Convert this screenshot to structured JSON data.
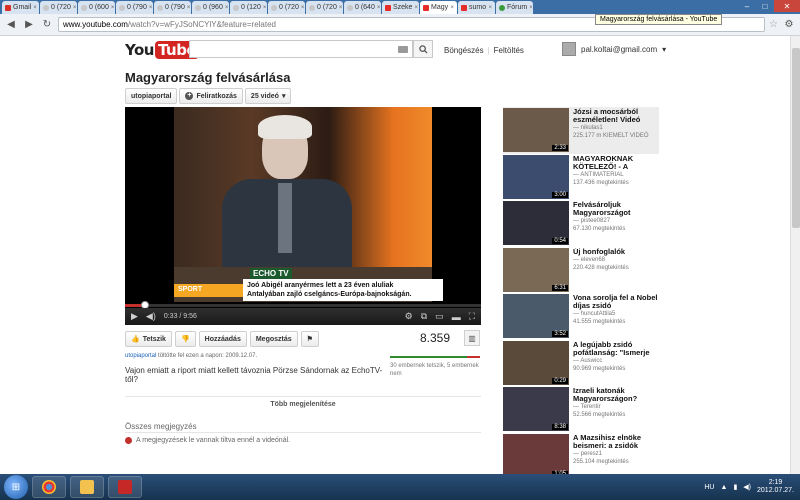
{
  "browser": {
    "tabs": [
      {
        "label": "Gmail",
        "icon": "gmail-icon",
        "active": false
      },
      {
        "label": "0 (720",
        "icon": "globe-icon",
        "active": false
      },
      {
        "label": "0 (600",
        "icon": "globe-icon",
        "active": false
      },
      {
        "label": "0 (790",
        "icon": "globe-icon",
        "active": false
      },
      {
        "label": "0 (790",
        "icon": "globe-icon",
        "active": false
      },
      {
        "label": "0 (960",
        "icon": "globe-icon",
        "active": false
      },
      {
        "label": "0 (120",
        "icon": "globe-icon",
        "active": false
      },
      {
        "label": "0 (720",
        "icon": "globe-icon",
        "active": false
      },
      {
        "label": "0 (720",
        "icon": "globe-icon",
        "active": false
      },
      {
        "label": "0 (640",
        "icon": "globe-icon",
        "active": false
      },
      {
        "label": "Szeke",
        "icon": "youtube-icon",
        "active": false
      },
      {
        "label": "Magy",
        "icon": "youtube-icon",
        "active": true
      },
      {
        "label": "sumo",
        "icon": "youtube-icon",
        "active": false
      },
      {
        "label": "Fórum",
        "icon": "green-icon",
        "active": false
      }
    ],
    "tooltip": "Magyarország felvásárlása - YouTube",
    "url_host": "www.youtube.com",
    "url_path": "/watch?v=wFyJSoNCYlY&feature=related"
  },
  "header": {
    "logo_you": "You",
    "logo_tube": "Tube",
    "browse": "Böngészés",
    "upload": "Feltöltés",
    "account": "pal.koltai@gmail.com",
    "account_caret": "▾"
  },
  "video": {
    "title": "Magyarország felvásárlása",
    "channel": "utopiaportal",
    "subscribe": "Feliratkozás",
    "count": "25 videó",
    "overlay_logo": "ECHO TV",
    "overlay_label": "SPORT",
    "overlay_line1": "Joó Abigél aranyérmes lett a 23 éven aluliak",
    "overlay_line2": "Antalyában zajló cselgáncs-Európa-bajnokságán.",
    "time": "0:33 / 9:56",
    "progress": 0.055,
    "like": "Tetszik",
    "add": "Hozzáadás",
    "share": "Megosztás",
    "views": "8.359",
    "like_ratio": 0.857,
    "likes_text": "30 embernek tetszik, 5 embernek nem",
    "uploader_name": "utopiaportal",
    "uploader_text": " töltötte fel ezen a napon: 2009.12.07.",
    "description": "Vajon emiatt a riport miatt kellett távoznia Pörzse Sándornak az EchoTV-től?",
    "more": "Több megjelenítése",
    "comments_header": "Összes megjegyzés",
    "comments_disabled": "A megjegyzések le vannak tiltva ennél a videónál."
  },
  "sidebar": {
    "items": [
      {
        "title": "Józsi a mocsárból eszméletlen! Videó",
        "channel": "— nikulas1",
        "views": "225.177 m",
        "badge": "KIEMELT VIDEÓ",
        "duration": "2:33"
      },
      {
        "title": "MAGYAROKNAK KÖTELEZŐ! - A",
        "channel": "— ANTIMATERIAL",
        "views": "137.436 megtekintés",
        "badge": "",
        "duration": "3:00"
      },
      {
        "title": "Felvásároljuk Magyarországot",
        "channel": "— pistee0827",
        "views": "67.130 megtekintés",
        "badge": "",
        "duration": "0:54"
      },
      {
        "title": "Új honfoglalók",
        "channel": "— eleven68",
        "views": "220.428 megtekintés",
        "badge": "",
        "duration": "6:31"
      },
      {
        "title": "Vona sorolja fel a Nobel díjas zsidó",
        "channel": "— huncutAttila5",
        "views": "41.555 megtekintés",
        "badge": "",
        "duration": "3:52"
      },
      {
        "title": "A legújabb zsidó pofátlanság: \"Ismerje",
        "channel": "— Auswicc",
        "views": "90.969 megtekintés",
        "badge": "",
        "duration": "0:29"
      },
      {
        "title": "Izraeli katonák Magyarországon?",
        "channel": "— Terentir",
        "views": "52.566 megtekintés",
        "badge": "",
        "duration": "8:38"
      },
      {
        "title": "A Mazsihisz elnöke beismeri: a zsidók",
        "channel": "— peresz1",
        "views": "255.104 megtekintés",
        "badge": "",
        "duration": "1:05"
      }
    ]
  },
  "taskbar": {
    "lang": "HU",
    "time": "2:19",
    "date": "2012.07.27."
  },
  "colors": {
    "accent": "#c4302b",
    "like": "#2d8c2d",
    "link": "#1c62b9"
  }
}
